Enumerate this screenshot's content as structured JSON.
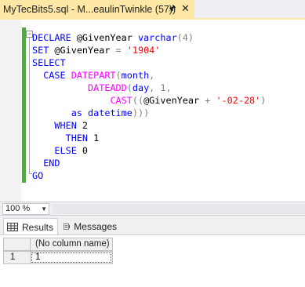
{
  "document_tab": {
    "title": "MyTecBits5.sql - M...eaulinTwinkle (57))",
    "pin_icon": "pin-icon",
    "close_icon": "close-icon"
  },
  "code_lines": [
    [
      {
        "t": "DECLARE",
        "c": "kw"
      },
      {
        "t": " @GivenYear ",
        "c": ""
      },
      {
        "t": "varchar",
        "c": "kw"
      },
      {
        "t": "(4)",
        "c": "op"
      }
    ],
    [
      {
        "t": "SET",
        "c": "kw"
      },
      {
        "t": " @GivenYear ",
        "c": ""
      },
      {
        "t": "=",
        "c": "op"
      },
      {
        "t": " ",
        "c": ""
      },
      {
        "t": "'1904'",
        "c": "str"
      }
    ],
    [
      {
        "t": "SELECT",
        "c": "kw"
      }
    ],
    [
      {
        "t": "  CASE ",
        "c": "kw"
      },
      {
        "t": "DATEPART",
        "c": "fn"
      },
      {
        "t": "(",
        "c": "op"
      },
      {
        "t": "month",
        "c": "kw"
      },
      {
        "t": ",",
        "c": "op"
      }
    ],
    [
      {
        "t": "          ",
        "c": ""
      },
      {
        "t": "DATEADD",
        "c": "fn"
      },
      {
        "t": "(",
        "c": "op"
      },
      {
        "t": "day",
        "c": "kw"
      },
      {
        "t": ", 1,",
        "c": "op"
      }
    ],
    [
      {
        "t": "              ",
        "c": ""
      },
      {
        "t": "CAST",
        "c": "fn"
      },
      {
        "t": "((",
        "c": "op"
      },
      {
        "t": "@GivenYear ",
        "c": ""
      },
      {
        "t": "+",
        "c": "op"
      },
      {
        "t": " ",
        "c": ""
      },
      {
        "t": "'-02-28'",
        "c": "str"
      },
      {
        "t": ")",
        "c": "op"
      }
    ],
    [
      {
        "t": "       ",
        "c": ""
      },
      {
        "t": "as ",
        "c": "kw"
      },
      {
        "t": "datetime",
        "c": "kw"
      },
      {
        "t": ")))",
        "c": "op"
      }
    ],
    [
      {
        "t": "    WHEN ",
        "c": "kw"
      },
      {
        "t": "2",
        "c": ""
      }
    ],
    [
      {
        "t": "      THEN ",
        "c": "kw"
      },
      {
        "t": "1",
        "c": ""
      }
    ],
    [
      {
        "t": "    ELSE ",
        "c": "kw"
      },
      {
        "t": "0",
        "c": ""
      }
    ],
    [
      {
        "t": "  END",
        "c": "kw"
      }
    ],
    [
      {
        "t": "GO",
        "c": "kw"
      }
    ]
  ],
  "zoom": {
    "value": "100 %"
  },
  "results_tabs": [
    {
      "label": "Results",
      "icon": "grid-icon",
      "active": true
    },
    {
      "label": "Messages",
      "icon": "messages-icon",
      "active": false
    }
  ],
  "grid": {
    "columns": [
      "(No column name)"
    ],
    "rows": [
      {
        "row_number": "1",
        "cells": [
          "1"
        ]
      }
    ]
  },
  "colors": {
    "keyword": "#0000ff",
    "function": "#ff00ff",
    "string": "#ff0000",
    "operator": "#808080",
    "active_tab": "#ffe8a6",
    "change_bar": "#57a64a"
  }
}
